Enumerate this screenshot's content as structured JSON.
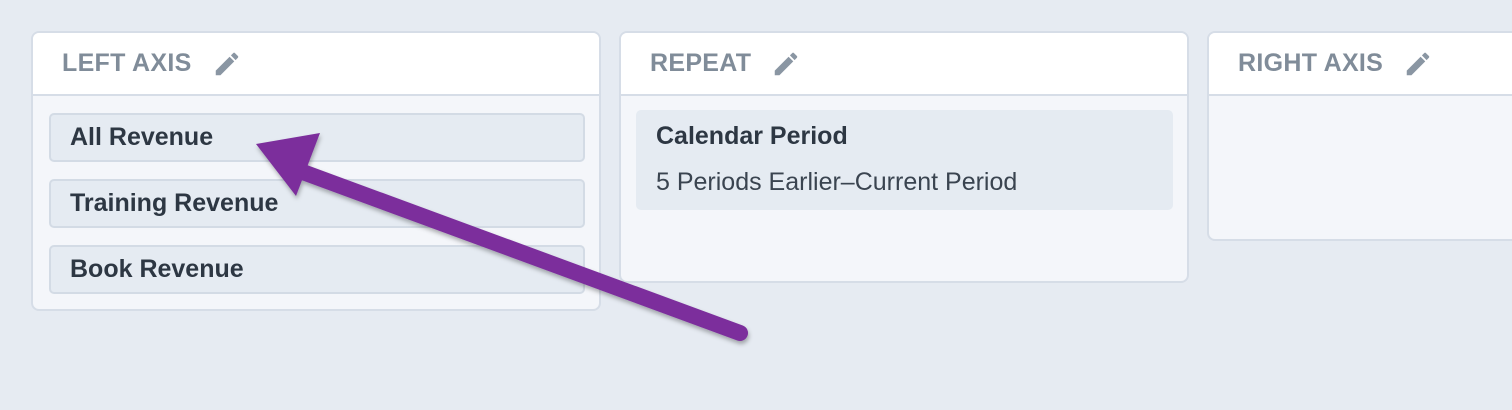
{
  "panels": {
    "left_axis": {
      "title": "LEFT AXIS",
      "items": [
        "All Revenue",
        "Training Revenue",
        "Book Revenue"
      ]
    },
    "repeat": {
      "title": "REPEAT",
      "card": {
        "title": "Calendar Period",
        "subtitle": "5 Periods Earlier–Current Period"
      }
    },
    "right_axis": {
      "title": "RIGHT AXIS",
      "items": []
    }
  },
  "icons": {
    "edit": "pencil-icon"
  },
  "colors": {
    "background": "#e6ebf2",
    "panel_header": "#ffffff",
    "panel_body": "#f4f6fa",
    "pill": "#e5ebf2",
    "header_text": "#808c99",
    "item_text": "#2d3743",
    "annotation_arrow": "#7b2f9c"
  }
}
